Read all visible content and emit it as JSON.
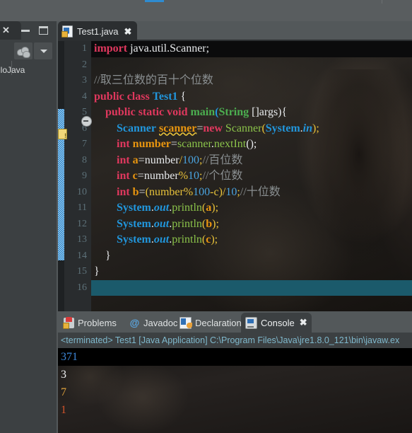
{
  "window": {
    "background_color": "#53585a",
    "accent_color": "#2f8bd0"
  },
  "left_panel": {
    "name": "package-explorer",
    "tab_close_label": "✕",
    "minimize_label": "",
    "maximize_label": "",
    "tree_item_label": "lloJava",
    "toolbar_caret_label": ""
  },
  "editor": {
    "tab": {
      "title": "Test1.java",
      "close_label": "✖"
    },
    "line_numbers": [
      "1",
      "2",
      "3",
      "4",
      "5",
      "6",
      "7",
      "8",
      "9",
      "10",
      "11",
      "12",
      "13",
      "14",
      "15",
      "16"
    ],
    "lines": [
      {
        "n": 1,
        "text": "import java.util.Scanner;"
      },
      {
        "n": 2,
        "text": ""
      },
      {
        "n": 3,
        "text": "//取三位数的百十个位数"
      },
      {
        "n": 4,
        "text": "public class Test1 {"
      },
      {
        "n": 5,
        "text": "    public static void main(String []args){"
      },
      {
        "n": 6,
        "text": "        Scanner scanner=new Scanner(System.in);"
      },
      {
        "n": 7,
        "text": "        int number=scanner.nextInt();"
      },
      {
        "n": 8,
        "text": "        int a=number/100;//百位数"
      },
      {
        "n": 9,
        "text": "        int c=number%10;//个位数"
      },
      {
        "n": 10,
        "text": "        int b=(number%100-c)/10;//十位数"
      },
      {
        "n": 11,
        "text": "        System.out.println(a);"
      },
      {
        "n": 12,
        "text": "        System.out.println(b);"
      },
      {
        "n": 13,
        "text": "        System.out.println(c);"
      },
      {
        "n": 14,
        "text": "    }"
      },
      {
        "n": 15,
        "text": "}"
      },
      {
        "n": 16,
        "text": ""
      }
    ],
    "tokens": {
      "kw_import": "import",
      "pkg_path": " java.util.Scanner;",
      "comment3": "//取三位数的百十个位数",
      "kw_public": "public",
      "kw_class": "class",
      "class_name": "Test1",
      "brace_open": "{",
      "kw_static": "static",
      "kw_void": "void",
      "method_main": "main",
      "paren_open": "(",
      "type_String": "String",
      "args": " []args){",
      "type_Scanner": "Scanner",
      "var_scanner": "scanner",
      "equals": "=",
      "kw_new": "new",
      "ctor_Scanner": "Scanner",
      "type_System": "System",
      "dot": ".",
      "field_in": "in",
      "paren_semi": ");",
      "kw_int": "int",
      "var_number": "number",
      "call_scanner": "scanner",
      "meth_nextInt": "nextInt",
      "empty_parens_semi": "();",
      "var_a": "a",
      "num_100": "100",
      "semi": ";",
      "comment_hundreds": "//百位数",
      "var_c": "c",
      "mod": "%",
      "num_10": "10",
      "comment_ones": "//个位数",
      "var_b": "b",
      "comment_tens": "//十位数",
      "sys_out": "out",
      "meth_println": "println",
      "arg_a": "a",
      "arg_b": "b",
      "arg_c": "c",
      "brace_close": "}",
      "minus_c": "-c)/",
      "div": "/",
      "paren_num": "(number"
    },
    "current_line": 16,
    "fold_marker_line": 5,
    "warning_line": 6,
    "warning_tooltip": ""
  },
  "console_panel": {
    "tabs": [
      {
        "label": "Problems",
        "icon": "problems-icon",
        "active": false
      },
      {
        "label": "Javadoc",
        "icon": "javadoc-icon",
        "active": false
      },
      {
        "label": "Declaration",
        "icon": "declaration-icon",
        "active": false
      },
      {
        "label": "Console",
        "icon": "console-icon",
        "active": true
      }
    ],
    "console_close_label": "✖",
    "status_line": "<terminated> Test1 [Java Application] C:\\Program Files\\Java\\jre1.8.0_121\\bin\\javaw.ex",
    "output": [
      {
        "text": "371",
        "kind": "input-echo",
        "color": "#3d87d8"
      },
      {
        "text": "3",
        "kind": "stdout",
        "color": "#f0f2f3"
      },
      {
        "text": "7",
        "kind": "stdout",
        "color": "#e0a23c"
      },
      {
        "text": "1",
        "kind": "stdout",
        "color": "#d2542a"
      }
    ]
  }
}
